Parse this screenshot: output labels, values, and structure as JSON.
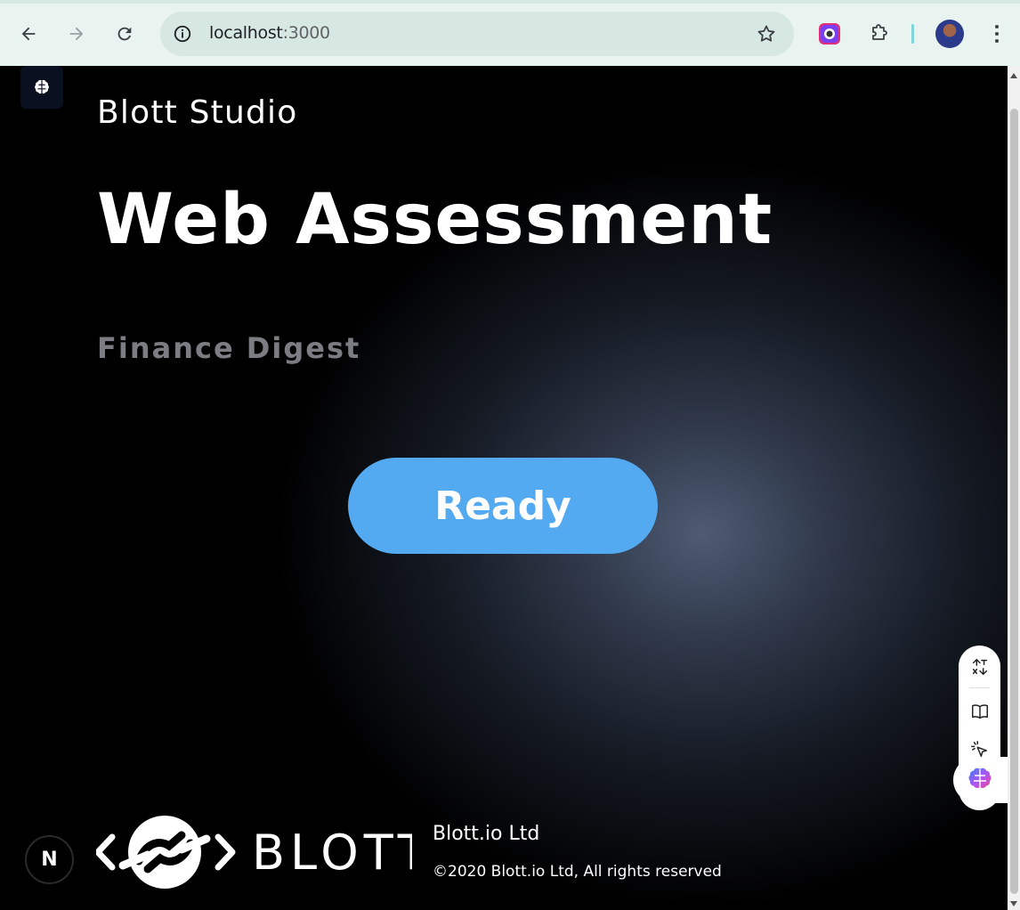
{
  "browser": {
    "url_host": "localhost",
    "url_port": ":3000"
  },
  "page": {
    "studio": "Blott Studio",
    "headline": "Web Assessment",
    "subheading": "Finance Digest",
    "ready_button": "Ready"
  },
  "footer": {
    "company": "Blott.io Ltd",
    "copyright": "©2020 Blott.io Ltd, All rights reserved",
    "logo_text": "BLOTT",
    "nextjs_badge": "N"
  },
  "colors": {
    "button": "#53aaf0",
    "subheading": "#7b7d83"
  }
}
